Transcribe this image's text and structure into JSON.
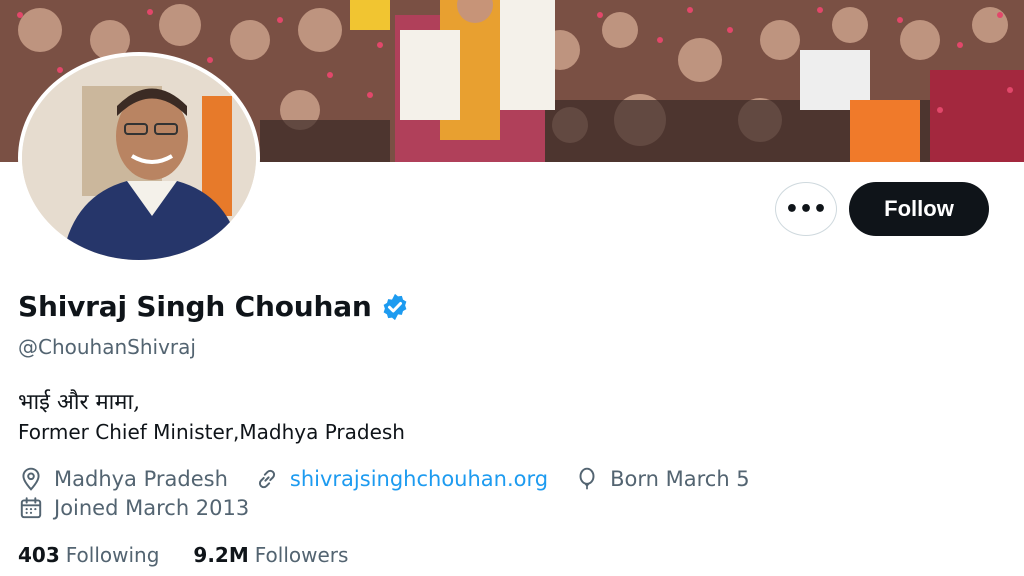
{
  "profile": {
    "display_name": "Shivraj Singh Chouhan",
    "handle": "@ChouhanShivraj",
    "verified": true,
    "bio_line1": "भाई और मामा,",
    "bio_line2": "Former Chief Minister,Madhya Pradesh"
  },
  "actions": {
    "more_label": "•••",
    "follow_label": "Follow"
  },
  "meta": {
    "location": "Madhya Pradesh",
    "website": "shivrajsinghchouhan.org",
    "birthday": "Born March 5",
    "joined": "Joined March 2013"
  },
  "stats": {
    "following_count": "403",
    "following_label": "Following",
    "followers_count": "9.2M",
    "followers_label": "Followers"
  },
  "icons": [
    "location-icon",
    "link-icon",
    "birthday-balloon-icon",
    "calendar-icon",
    "verified-badge-icon",
    "more-options-icon"
  ],
  "colors": {
    "link": "#1d9bf0",
    "secondary_text": "#536471",
    "primary_text": "#0f1419",
    "follow_button_bg": "#0f1419",
    "verified_badge": "#1d9bf0"
  }
}
